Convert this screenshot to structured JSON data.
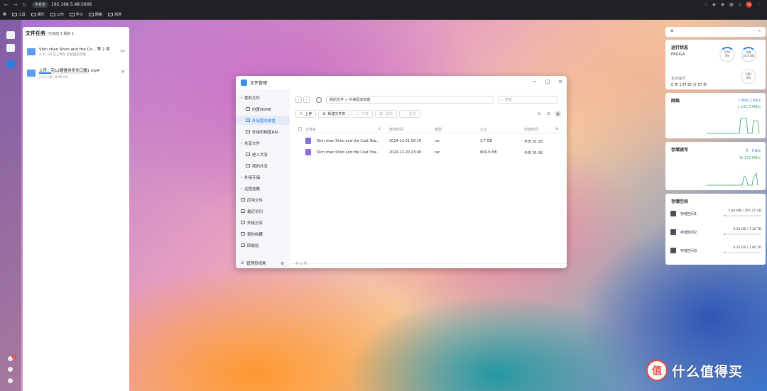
{
  "browser": {
    "security_label": "不安全",
    "address": "192.168.5.48:5666",
    "profile_initial": "TB",
    "bookmarks": [
      "工具",
      "娱乐",
      "公司",
      "学习",
      "网络",
      "测评"
    ]
  },
  "tasks": {
    "title": "文件任务",
    "summary": "已完成 1 剩余 1",
    "items": [
      {
        "name": "Shin chan Shiro and the Co... 等 2 项",
        "meta": "4.31 GB    已上传至 外接固态单盘",
        "progress": 1.0
      },
      {
        "name": "上传：完12硬盘拼多多口播1.mp4",
        "meta": "2.11 GB / 8.96 GB",
        "progress": 0.24
      }
    ]
  },
  "file_manager": {
    "title": "文件管理",
    "breadcrumb": "我的文件 > 外接固态单盘",
    "search_placeholder": "搜索",
    "toolbar": {
      "upload": "上传",
      "new_folder": "新建文件夹",
      "download": "下载",
      "delete": "删除",
      "more": "更多"
    },
    "sidebar": {
      "my_files": "我的文件",
      "nvme": "内置NVME",
      "ext_ssd": "外接固态单盘",
      "ext_raid": "外接机械盘RAI",
      "shared": "共享文件",
      "others_share": "他人共享",
      "my_share": "我的共享",
      "external": "外接存储",
      "remote": "远程挂载",
      "app_files": "应用文件",
      "recent": "最近访问",
      "ext_share": "外链分享",
      "favorites": "我的收藏",
      "trash": "回收站",
      "admin_view": "管理员视角"
    },
    "columns": {
      "name": "文件名",
      "modified": "修改时间",
      "type": "类型",
      "size": "大小",
      "created": "创建时间"
    },
    "rows": [
      {
        "name": "Shin chan Shiro and the Coat Tow...",
        "modified": "2024-12-21 00:10",
        "type": "rar",
        "size": "3.7 GB",
        "created": "今天 01:16"
      },
      {
        "name": "Shin chan Shiro and the Coat Tow...",
        "modified": "2024-12-20 23:48",
        "type": "rar",
        "size": "609.9 MB",
        "created": "今天 01:16"
      }
    ],
    "footer": "共 2 项"
  },
  "widgets": {
    "status": {
      "title": "运行状态",
      "device": "FNGIGA",
      "cpu_label": "CPU",
      "cpu_value": "0%",
      "mem_label": "内存",
      "mem_value": "10.4 GB",
      "gpu_label": "GPU",
      "gpu_value": "0%",
      "uptime_label": "本次运行",
      "uptime": "0 天 1 时 35 分 57 秒"
    },
    "network": {
      "title": "网络",
      "up": "600.2 KB/s",
      "down": "165.3 MB/s"
    },
    "storage_rw": {
      "title": "存储读写",
      "read_label": "R",
      "read": "0 B/s",
      "write_label": "W",
      "write": "172 MB/s"
    },
    "storage_space": {
      "title": "存储空间",
      "disks": [
        {
          "name": "存储空间1",
          "usage": "5.84 MB / 365.37 GB",
          "fraction": 0.02
        },
        {
          "name": "存储空间2",
          "usage": "4.32 GB / 7.28 TB",
          "fraction": 0.01
        },
        {
          "name": "存储空间3",
          "usage": "4.32 GB / 1.66 TB",
          "fraction": 0.02
        }
      ]
    }
  },
  "watermark": {
    "logo_char": "值",
    "text": "什么值得买"
  },
  "icons": {
    "back": "back-arrow-icon",
    "forward": "forward-arrow-icon",
    "reload": "reload-icon",
    "star": "star-icon",
    "menu": "kebab-menu-icon"
  },
  "colors": {
    "accent": "#2b7bde",
    "rar_file": "#8a6de0",
    "badge": "#e53935",
    "net_graph": "#3aa66b"
  }
}
